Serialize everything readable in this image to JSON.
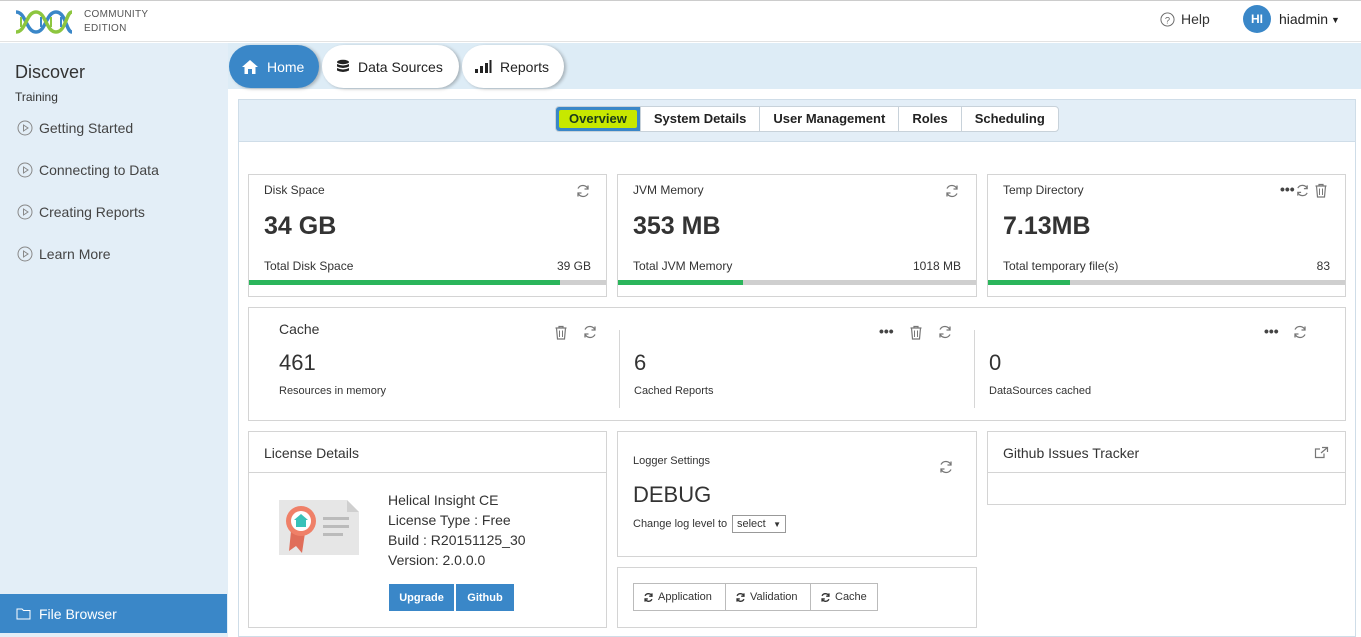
{
  "brand": {
    "line1": "COMMUNITY",
    "line2": "EDITION"
  },
  "header": {
    "help": "Help",
    "avatar": "HI",
    "username": "hiadmin"
  },
  "sidebar": {
    "title": "Discover",
    "subtitle": "Training",
    "items": [
      {
        "label": "Getting Started"
      },
      {
        "label": "Connecting to Data"
      },
      {
        "label": "Creating Reports"
      },
      {
        "label": "Learn More"
      }
    ],
    "file_browser": "File Browser"
  },
  "nav": {
    "home": "Home",
    "data_sources": "Data Sources",
    "reports": "Reports"
  },
  "subtabs": [
    "Overview",
    "System Details",
    "User Management",
    "Roles",
    "Scheduling"
  ],
  "disk": {
    "label": "Disk Space",
    "value": "34 GB",
    "total_label": "Total Disk Space",
    "total": "39 GB",
    "fill": 0.87
  },
  "jvm": {
    "label": "JVM Memory",
    "value": "353 MB",
    "total_label": "Total JVM Memory",
    "total": "1018 MB",
    "fill": 0.35
  },
  "temp": {
    "label": "Temp Directory",
    "value": "7.13MB",
    "total_label": "Total temporary file(s)",
    "total": "83",
    "fill": 0.23
  },
  "cache": {
    "title": "Cache",
    "resources": {
      "value": "461",
      "label": "Resources in memory"
    },
    "reports": {
      "value": "6",
      "label": "Cached Reports"
    },
    "datasources": {
      "value": "0",
      "label": "DataSources cached"
    }
  },
  "license": {
    "title": "License Details",
    "product": "Helical Insight CE",
    "type": "License Type : Free",
    "build": "Build : R20151125_30",
    "version": "Version: 2.0.0.0",
    "upgrade": "Upgrade",
    "github": "Github"
  },
  "logger": {
    "title": "Logger Settings",
    "level": "DEBUG",
    "change_label": "Change log level to",
    "select_value": "select"
  },
  "refresh": {
    "application": "Application",
    "validation": "Validation",
    "cache": "Cache"
  },
  "github_tracker": {
    "title": "Github Issues Tracker"
  },
  "colors": {
    "accent": "#3a87c8",
    "progress": "#2bb55b",
    "highlight": "#c7e800"
  }
}
